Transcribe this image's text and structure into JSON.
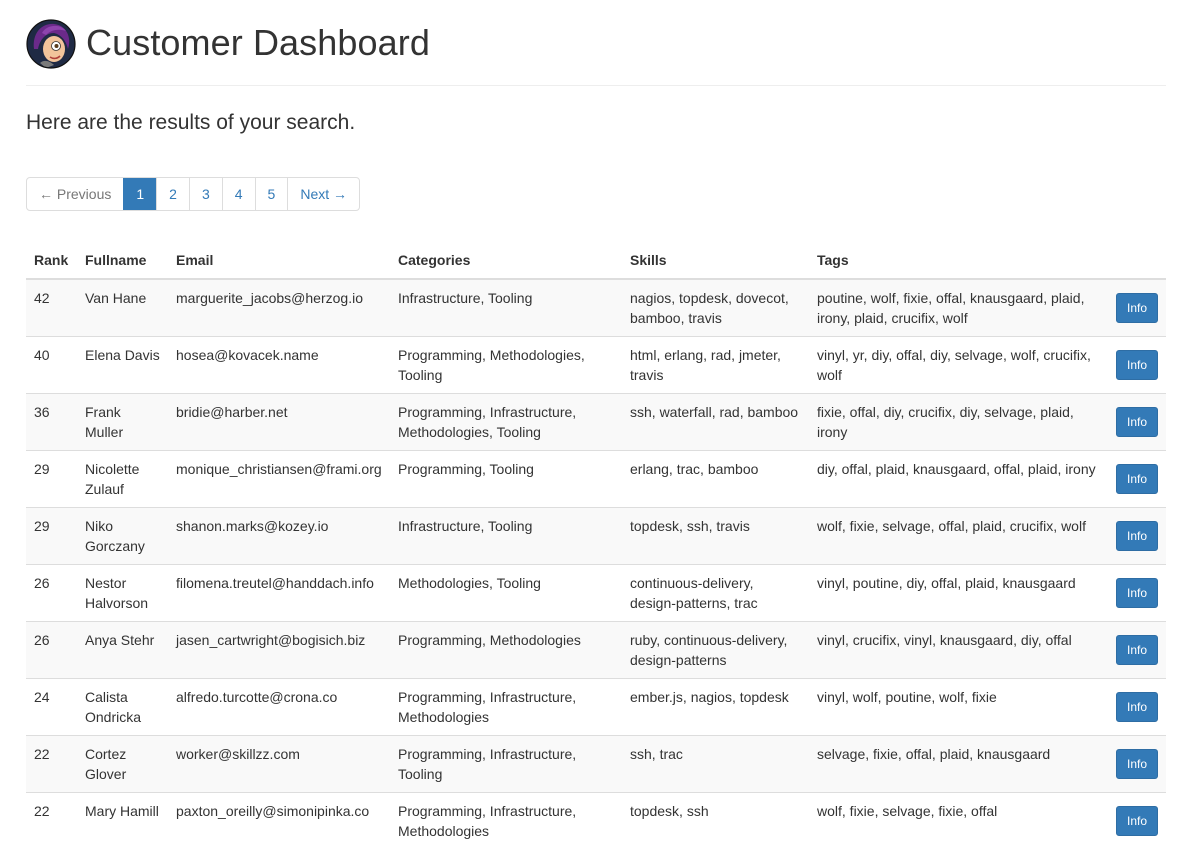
{
  "header": {
    "title": "Customer Dashboard",
    "avatar_icon": "cartoon-avatar-icon"
  },
  "lead": "Here are the results of your search.",
  "pagination": {
    "previous": "← Previous",
    "pages": [
      "1",
      "2",
      "3",
      "4",
      "5"
    ],
    "active_page": "1",
    "next": "Next →"
  },
  "table": {
    "columns": [
      "Rank",
      "Fullname",
      "Email",
      "Categories",
      "Skills",
      "Tags",
      ""
    ],
    "rows": [
      {
        "rank": "42",
        "fullname": "Van Hane",
        "email": "marguerite_jacobs@herzog.io",
        "categories": "Infrastructure, Tooling",
        "skills": "nagios, topdesk, dovecot, bamboo, travis",
        "tags": "poutine, wolf, fixie, offal, knausgaard, plaid, irony, plaid, crucifix, wolf",
        "action": "Info"
      },
      {
        "rank": "40",
        "fullname": "Elena Davis",
        "email": "hosea@kovacek.name",
        "categories": "Programming, Methodologies, Tooling",
        "skills": "html, erlang, rad, jmeter, travis",
        "tags": "vinyl, yr, diy, offal, diy, selvage, wolf, crucifix, wolf",
        "action": "Info"
      },
      {
        "rank": "36",
        "fullname": "Frank Muller",
        "email": "bridie@harber.net",
        "categories": "Programming, Infrastructure, Methodologies, Tooling",
        "skills": "ssh, waterfall, rad, bamboo",
        "tags": "fixie, offal, diy, crucifix, diy, selvage, plaid, irony",
        "action": "Info"
      },
      {
        "rank": "29",
        "fullname": "Nicolette Zulauf",
        "email": "monique_christiansen@frami.org",
        "categories": "Programming, Tooling",
        "skills": "erlang, trac, bamboo",
        "tags": "diy, offal, plaid, knausgaard, offal, plaid, irony",
        "action": "Info"
      },
      {
        "rank": "29",
        "fullname": "Niko Gorczany",
        "email": "shanon.marks@kozey.io",
        "categories": "Infrastructure, Tooling",
        "skills": "topdesk, ssh, travis",
        "tags": "wolf, fixie, selvage, offal, plaid, crucifix, wolf",
        "action": "Info"
      },
      {
        "rank": "26",
        "fullname": "Nestor Halvorson",
        "email": "filomena.treutel@handdach.info",
        "categories": "Methodologies, Tooling",
        "skills": "continuous-delivery, design-patterns, trac",
        "tags": "vinyl, poutine, diy, offal, plaid, knausgaard",
        "action": "Info"
      },
      {
        "rank": "26",
        "fullname": "Anya Stehr",
        "email": "jasen_cartwright@bogisich.biz",
        "categories": "Programming, Methodologies",
        "skills": "ruby, continuous-delivery, design-patterns",
        "tags": "vinyl, crucifix, vinyl, knausgaard, diy, offal",
        "action": "Info"
      },
      {
        "rank": "24",
        "fullname": "Calista Ondricka",
        "email": "alfredo.turcotte@crona.co",
        "categories": "Programming, Infrastructure, Methodologies",
        "skills": "ember.js, nagios, topdesk",
        "tags": "vinyl, wolf, poutine, wolf, fixie",
        "action": "Info"
      },
      {
        "rank": "22",
        "fullname": "Cortez Glover",
        "email": "worker@skillzz.com",
        "categories": "Programming, Infrastructure, Tooling",
        "skills": "ssh, trac",
        "tags": "selvage, fixie, offal, plaid, knausgaard",
        "action": "Info"
      },
      {
        "rank": "22",
        "fullname": "Mary Hamill",
        "email": "paxton_oreilly@simonipinka.co",
        "categories": "Programming, Infrastructure, Methodologies",
        "skills": "topdesk, ssh",
        "tags": "wolf, fixie, selvage, fixie, offal",
        "action": "Info"
      }
    ]
  },
  "colors": {
    "primary": "#337ab7",
    "text": "#333333",
    "border": "#dddddd",
    "stripe": "#f9f9f9"
  }
}
